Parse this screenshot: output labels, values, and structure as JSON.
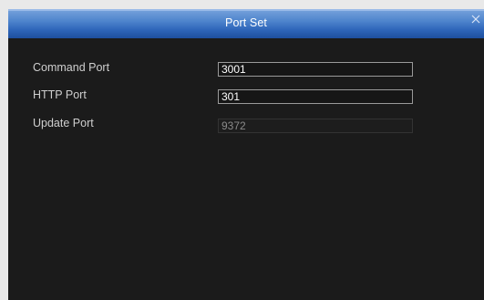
{
  "dialog": {
    "title": "Port Set",
    "close_icon": "close-icon"
  },
  "fields": [
    {
      "label": "Command Port",
      "value": "3001",
      "enabled": true
    },
    {
      "label": "HTTP Port",
      "value": "301",
      "enabled": true
    },
    {
      "label": "Update Port",
      "value": "9372",
      "enabled": false
    }
  ],
  "colors": {
    "titlebar": "#3a6fc2",
    "background": "#1b1b1b",
    "label_text": "#cfcfcf",
    "disabled_text": "#8a8a8a"
  }
}
